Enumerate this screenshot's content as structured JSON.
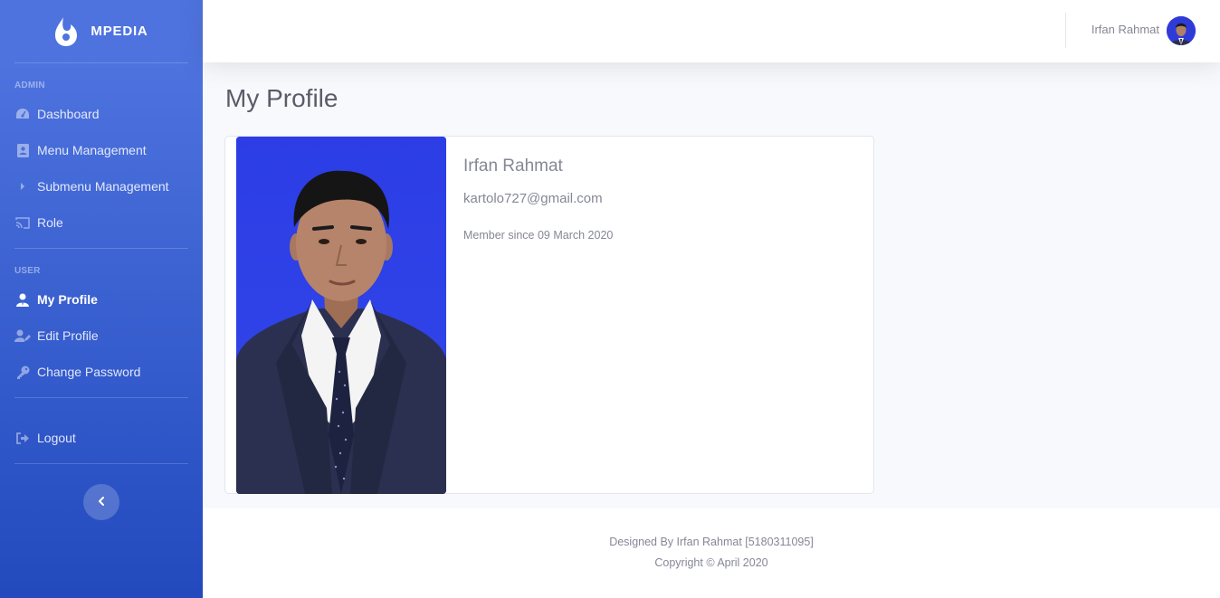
{
  "brand": {
    "name": "MPEDIA",
    "icon": "laugh-wink-icon"
  },
  "sidebar": {
    "sections": [
      {
        "heading": "ADMIN"
      },
      {
        "heading": "USER"
      }
    ],
    "admin_items": [
      {
        "label": "Dashboard",
        "icon": "tachometer-icon"
      },
      {
        "label": "Menu Management",
        "icon": "address-book-icon"
      },
      {
        "label": "Submenu Management",
        "icon": "caret-right-icon"
      },
      {
        "label": "Role",
        "icon": "chromecast-icon"
      }
    ],
    "user_items": [
      {
        "label": "My Profile",
        "icon": "user-tie-icon",
        "active": true
      },
      {
        "label": "Edit Profile",
        "icon": "user-edit-icon"
      },
      {
        "label": "Change Password",
        "icon": "key-icon"
      }
    ],
    "logout": {
      "label": "Logout",
      "icon": "sign-out-icon"
    },
    "toggle_icon": "chevron-left-icon"
  },
  "topbar": {
    "user_name": "Irfan Rahmat"
  },
  "page": {
    "title": "My Profile"
  },
  "profile": {
    "name": "Irfan Rahmat",
    "email": "kartolo727@gmail.com",
    "member_since": "Member since 09 March 2020"
  },
  "footer": {
    "line1": "Designed By Irfan Rahmat [5180311095]",
    "line2": "Copyright © April 2020"
  },
  "colors": {
    "primary": "#4e73df",
    "primary_dark": "#224abe",
    "text_muted": "#858796",
    "heading": "#5a5c69",
    "photo_bg": "#2a3be0"
  }
}
